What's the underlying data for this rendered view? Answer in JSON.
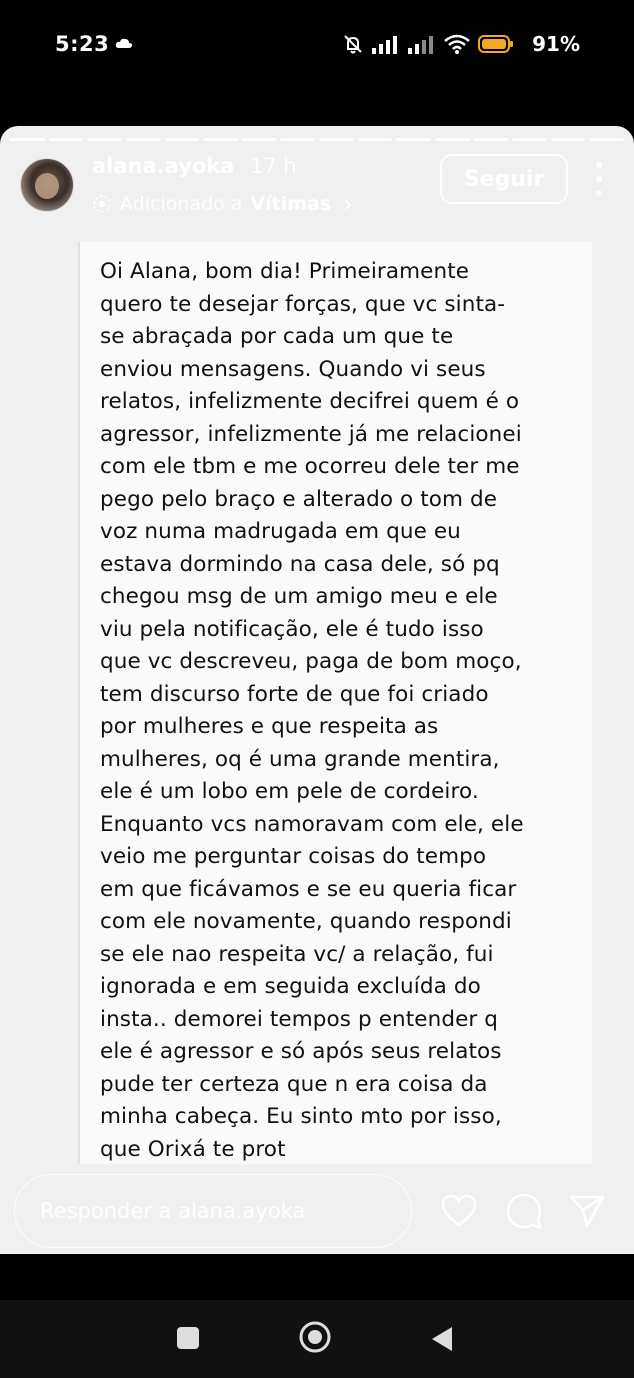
{
  "status_bar": {
    "time": "5:23",
    "battery_percent": "91%",
    "battery_color": "#f5a623"
  },
  "story": {
    "username": "alana.ayoka",
    "time_ago": "17 h",
    "added_prefix": "Adicionado a",
    "added_collection": "Vítimas",
    "added_chevron": "›",
    "follow_label": "Seguir",
    "progress_segments": 16,
    "active_segment": 1
  },
  "message": {
    "text": "Oi Alana, bom dia! Primeiramente\nquero te desejar forças, que vc sinta-\nse abraçada por cada um que te\nenviou mensagens. Quando vi seus\nrelatos, infelizmente decifrei quem é o\nagressor, infelizmente já me relacionei\ncom ele tbm e me ocorreu dele ter me\npego pelo braço e alterado o tom de\nvoz numa madrugada em que eu\nestava dormindo na casa dele, só pq\nchegou msg de um amigo meu e ele\nviu pela notificação, ele é tudo isso\nque vc descreveu, paga de bom moço,\ntem discurso forte de que foi criado\npor mulheres e que respeita as\nmulheres, oq é uma grande mentira,\nele é um lobo em pele de cordeiro.\nEnquanto vcs namoravam com ele, ele\nveio me perguntar  coisas do tempo\nem que ficávamos e se eu queria ficar\ncom ele novamente, quando respondi\nse ele nao respeita vc/ a relação, fui\nignorada e em seguida excluída do\ninsta.. demorei tempos p entender q\nele é agressor e só após seus relatos\npude ter certeza que n era coisa da\nminha cabeça. Eu sinto mto por isso,\nque Orixá te prot"
  },
  "reply": {
    "placeholder": "Responder a alana.ayoka"
  },
  "icons": {
    "like": "heart-icon",
    "comment": "comment-icon",
    "share": "send-icon",
    "more": "more-vertical-icon"
  }
}
